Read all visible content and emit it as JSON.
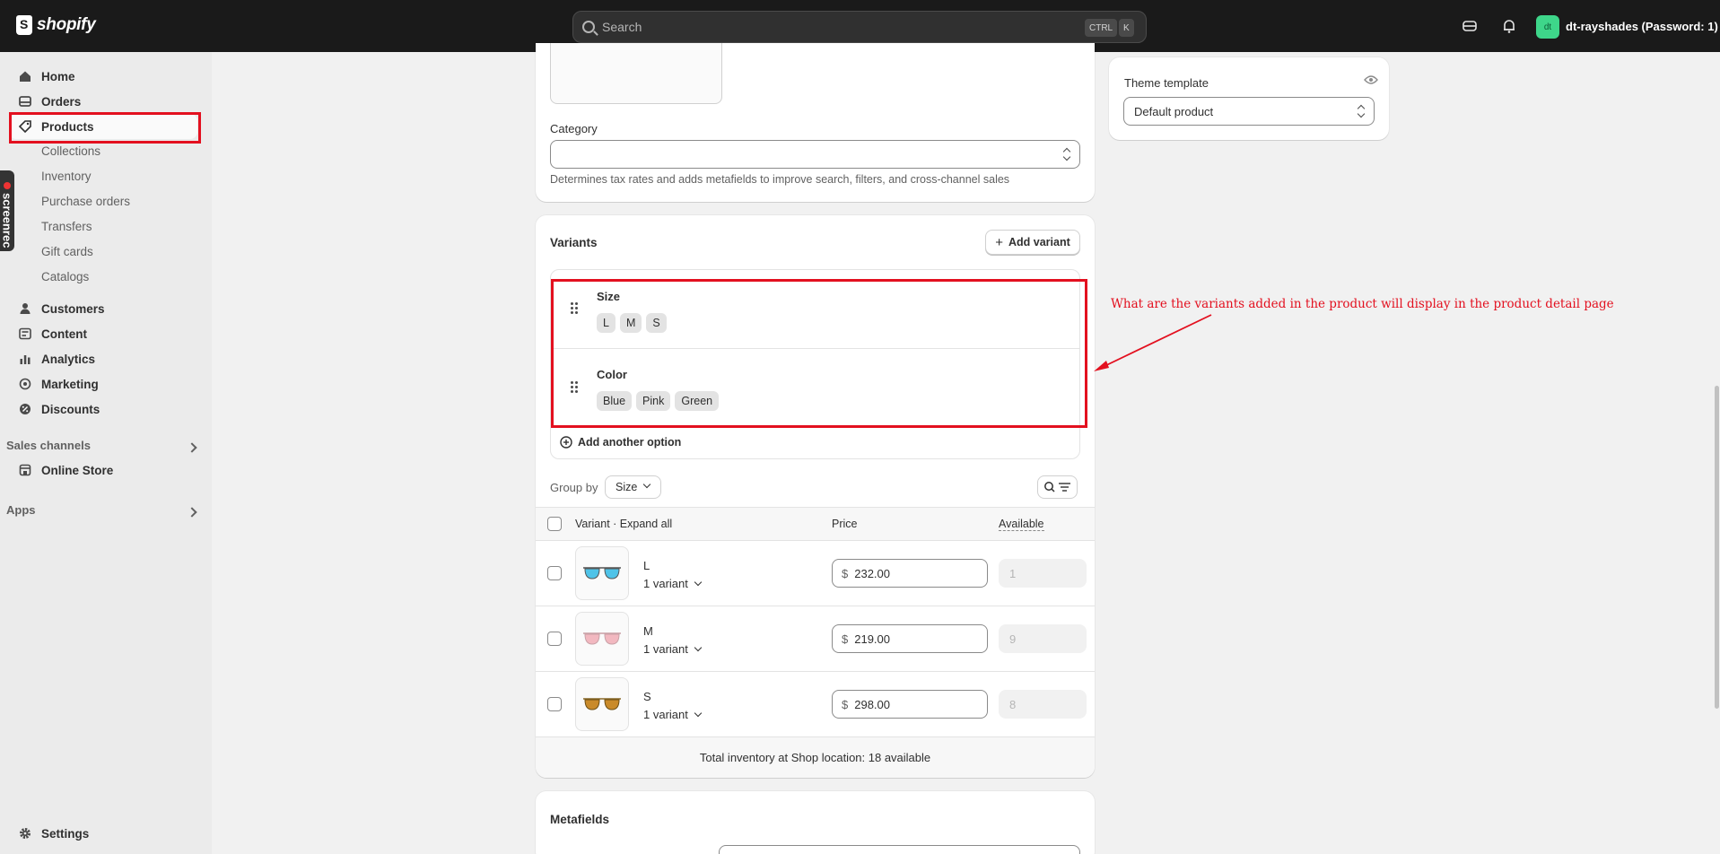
{
  "topbar": {
    "logo_text": "shopify",
    "search_placeholder": "Search",
    "shortcut_ctrl": "CTRL",
    "shortcut_key": "K",
    "avatar_initials": "dt",
    "store_name": "dt-rayshades (Password: 1)",
    "icons": [
      "store-icon",
      "bell-icon"
    ]
  },
  "sidebar": {
    "items": [
      {
        "label": "Home",
        "icon": "home-icon"
      },
      {
        "label": "Orders",
        "icon": "inbox-icon"
      },
      {
        "label": "Products",
        "icon": "tag-icon"
      }
    ],
    "product_subitems": [
      "Collections",
      "Inventory",
      "Purchase orders",
      "Transfers",
      "Gift cards",
      "Catalogs"
    ],
    "items2": [
      {
        "label": "Customers",
        "icon": "person-icon"
      },
      {
        "label": "Content",
        "icon": "content-icon"
      },
      {
        "label": "Analytics",
        "icon": "chart-icon"
      },
      {
        "label": "Marketing",
        "icon": "target-icon"
      },
      {
        "label": "Discounts",
        "icon": "discount-icon"
      }
    ],
    "sales_channels_label": "Sales channels",
    "online_store_label": "Online Store",
    "apps_label": "Apps",
    "settings_label": "Settings",
    "screenrec_label": "screenrec"
  },
  "product": {
    "category_label": "Category",
    "category_value": "",
    "category_help": "Determines tax rates and adds metafields to improve search, filters, and cross-channel sales"
  },
  "theme": {
    "label": "Theme template",
    "value": "Default product"
  },
  "variants": {
    "title": "Variants",
    "add_variant_label": "Add variant",
    "options": [
      {
        "name": "Size",
        "values": [
          "L",
          "M",
          "S"
        ]
      },
      {
        "name": "Color",
        "values": [
          "Blue",
          "Pink",
          "Green"
        ]
      }
    ],
    "add_option_label": "Add another option",
    "group_by_label": "Group by",
    "group_by_value": "Size",
    "table_headers": {
      "variant": "Variant",
      "expand_all": "Expand all",
      "price": "Price",
      "available": "Available"
    },
    "rows": [
      {
        "name": "L",
        "sub": "1 variant",
        "currency": "$",
        "price": "232.00",
        "available": "1",
        "lens_color": "#4fc3e8"
      },
      {
        "name": "M",
        "sub": "1 variant",
        "currency": "$",
        "price": "219.00",
        "available": "9",
        "lens_color": "#f2b8c0"
      },
      {
        "name": "S",
        "sub": "1 variant",
        "currency": "$",
        "price": "298.00",
        "available": "8",
        "lens_color": "#c98a2a"
      }
    ],
    "total_inventory": "Total inventory at Shop location: 18 available"
  },
  "metafields": {
    "title": "Metafields"
  },
  "annotation": {
    "text": "What are the variants added in the product will display in the product detail page",
    "color": "#e3101f"
  }
}
